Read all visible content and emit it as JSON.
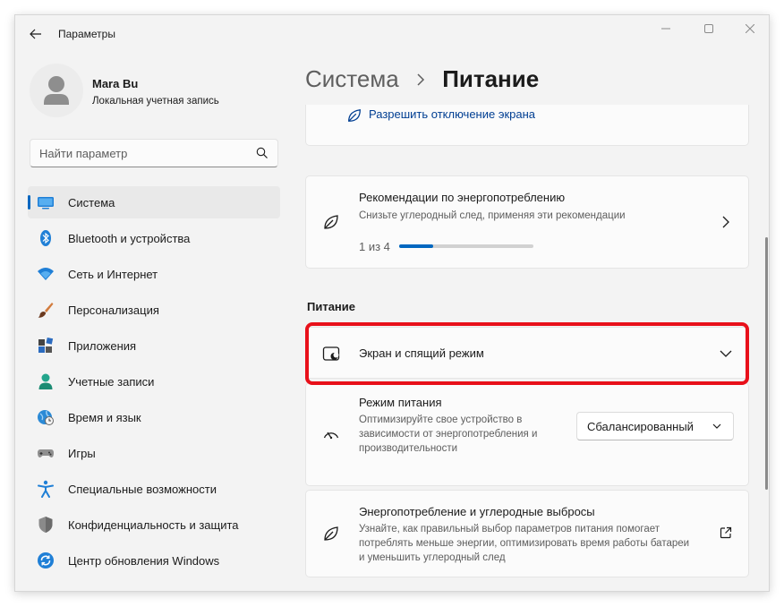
{
  "window": {
    "title": "Параметры"
  },
  "profile": {
    "name": "Mara Bu",
    "account_type": "Локальная учетная запись"
  },
  "search": {
    "placeholder": "Найти параметр"
  },
  "sidebar": {
    "items": [
      {
        "label": "Система",
        "icon": "system-display-icon",
        "active": true
      },
      {
        "label": "Bluetooth и устройства",
        "icon": "bluetooth-icon"
      },
      {
        "label": "Сеть и Интернет",
        "icon": "wifi-icon"
      },
      {
        "label": "Персонализация",
        "icon": "brush-icon"
      },
      {
        "label": "Приложения",
        "icon": "apps-icon"
      },
      {
        "label": "Учетные записи",
        "icon": "account-icon"
      },
      {
        "label": "Время и язык",
        "icon": "globe-clock-icon"
      },
      {
        "label": "Игры",
        "icon": "gamepad-icon"
      },
      {
        "label": "Специальные возможности",
        "icon": "accessibility-icon"
      },
      {
        "label": "Конфиденциальность и защита",
        "icon": "shield-icon"
      },
      {
        "label": "Центр обновления Windows",
        "icon": "update-icon"
      }
    ]
  },
  "breadcrumb": {
    "parent": "Система",
    "separator": "›",
    "current": "Питание"
  },
  "main": {
    "screen_off_link": "Разрешить отключение экрана",
    "recommendations": {
      "title": "Рекомендации по энергопотреблению",
      "description": "Снизьте углеродный след, применяя эти рекомендации",
      "progress_text": "1 из 4",
      "progress_fraction": 0.25
    },
    "section_title": "Питание",
    "screen_sleep": {
      "title": "Экран и спящий режим"
    },
    "power_mode": {
      "title": "Режим питания",
      "description": "Оптимизируйте свое устройство в зависимости от энергопотребления и производительности",
      "selected": "Сбалансированный"
    },
    "energy": {
      "title": "Энергопотребление и углеродные выбросы",
      "description": "Узнайте, как правильный выбор параметров питания помогает потреблять меньше энергии, оптимизировать время работы батареи и уменьшить углеродный след"
    }
  },
  "colors": {
    "accent": "#0067c0",
    "highlight": "#e8101a",
    "window_bg": "#f3f3f3",
    "card_bg": "#fbfbfb"
  }
}
